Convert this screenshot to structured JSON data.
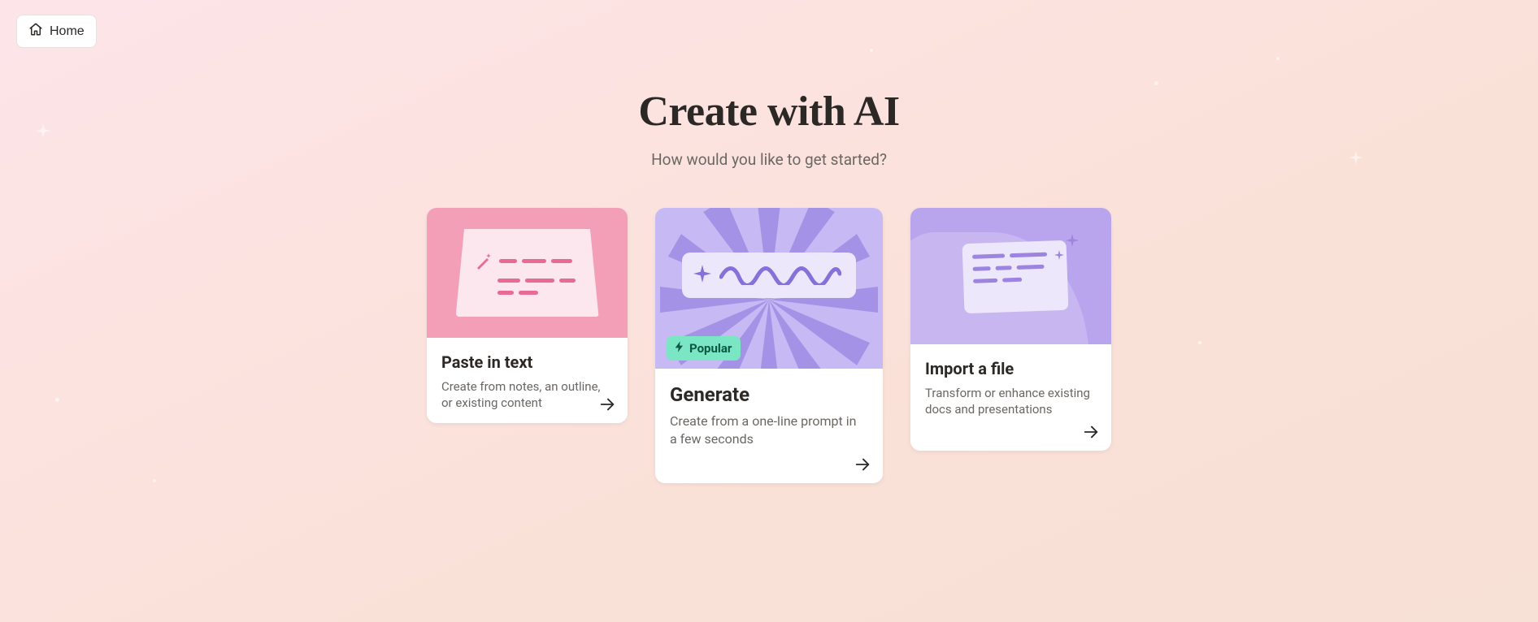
{
  "nav": {
    "home_label": "Home"
  },
  "page": {
    "title": "Create with AI",
    "subtitle": "How would you like to get started?"
  },
  "cards": {
    "paste": {
      "title": "Paste in text",
      "description": "Create from notes, an outline, or existing content"
    },
    "generate": {
      "title": "Generate",
      "description": "Create from a one-line prompt in a few seconds",
      "badge_label": "Popular"
    },
    "import": {
      "title": "Import a file",
      "description": "Transform or enhance existing docs and presentations"
    }
  }
}
